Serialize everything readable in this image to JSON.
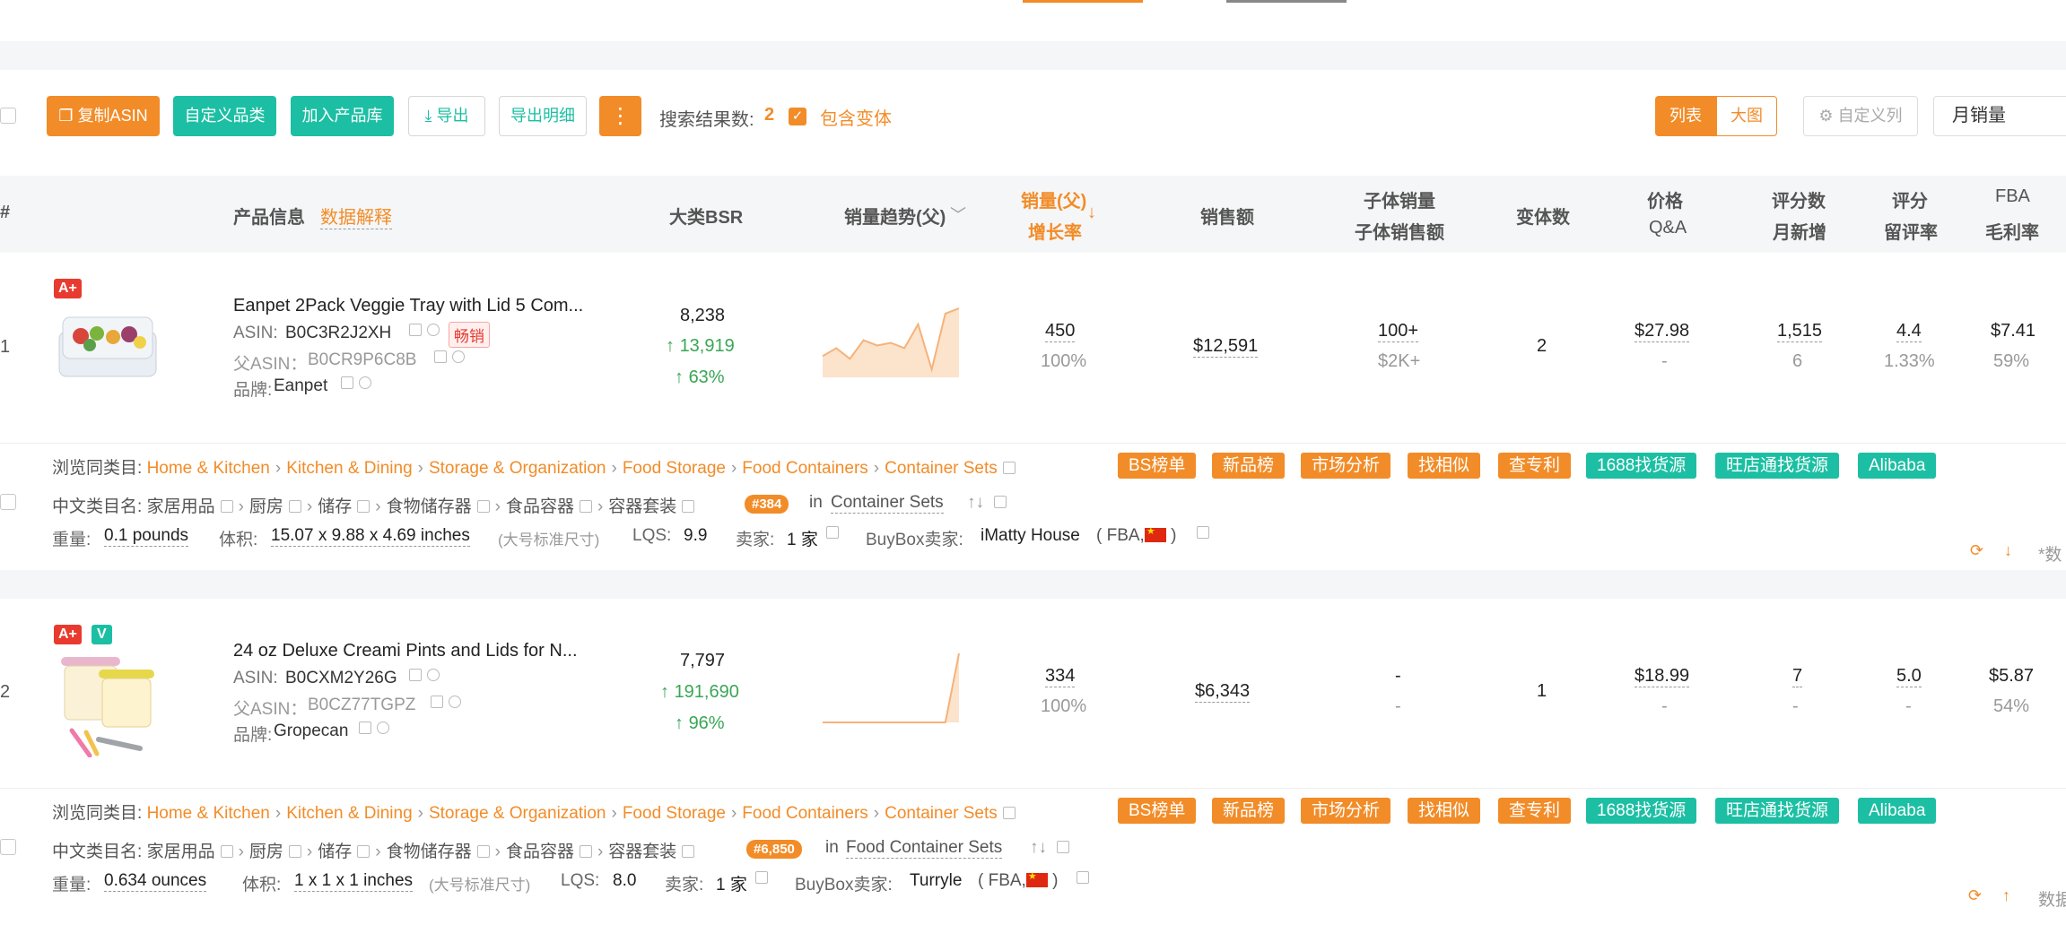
{
  "toolbar": {
    "copy_asin": "复制ASIN",
    "custom_category": "自定义品类",
    "add_library": "加入产品库",
    "export": "导出",
    "export_detail": "导出明细",
    "more": "⋮",
    "result_label": "搜索结果数:",
    "result_count": "2",
    "include_variants": "包含变体",
    "view_list": "列表",
    "view_grid": "大图",
    "custom_columns": "自定义列",
    "sort_select": "月销量"
  },
  "table": {
    "headers": {
      "index": "#",
      "product_info": "产品信息",
      "data_explain": "数据解释",
      "bsr": "大类BSR",
      "trend": "销量趋势(父)",
      "sales_parent": "销量(父)",
      "growth_rate": "增长率",
      "revenue": "销售额",
      "child_sales": "子体销量",
      "child_revenue": "子体销售额",
      "variants": "变体数",
      "price": "价格",
      "qa": "Q&A",
      "reviews": "评分数",
      "monthly_new": "月新增",
      "rating": "评分",
      "retention": "留评率",
      "fba": "FBA",
      "margin": "毛利率"
    },
    "rows": [
      {
        "index": "1",
        "badge_a": "A+",
        "title": "Eanpet 2Pack Veggie Tray with Lid 5 Com...",
        "asin_label": "ASIN:",
        "asin": "B0C3R2J2XH",
        "hot": "畅销",
        "parent_label": "父ASIN：",
        "parent_asin": "B0CR9P6C8B",
        "brand_label": "品牌:",
        "brand": "Eanpet",
        "bsr": "8,238",
        "bsr_change": "13,919",
        "bsr_pct": "63%",
        "sales": "450",
        "growth": "100%",
        "revenue": "$12,591",
        "child_sales": "100+",
        "child_revenue": "$2K+",
        "variants": "2",
        "price": "$27.98",
        "qa": "-",
        "reviews": "1,515",
        "monthly_new": "6",
        "rating": "4.4",
        "retention": "1.33%",
        "fba": "$7.41",
        "margin": "59%",
        "browse_label": "浏览同类目:",
        "crumbs": [
          "Home & Kitchen",
          "Kitchen & Dining",
          "Storage & Organization",
          "Food Storage",
          "Food Containers",
          "Container Sets"
        ],
        "cn_label": "中文类目名:",
        "cn_crumbs": [
          "家居用品",
          "厨房",
          "储存",
          "食物储存器",
          "食品容器",
          "容器套装"
        ],
        "rank": "#384",
        "rank_in": "in",
        "rank_cat": "Container Sets",
        "weight_label": "重量:",
        "weight": "0.1 pounds",
        "volume_label": "体积:",
        "volume": "15.07 x 9.88 x 4.69 inches",
        "size_note": "(大号标准尺寸)",
        "lqs_label": "LQS:",
        "lqs": "9.9",
        "seller_label": "卖家:",
        "seller": "1 家",
        "buybox_label": "BuyBox卖家:",
        "buybox": "iMatty House",
        "buybox_fba": "( FBA,",
        "buybox_close": ")",
        "trend": [
          40,
          55,
          35,
          70,
          60,
          65,
          55,
          100,
          15,
          120,
          130
        ]
      },
      {
        "index": "2",
        "badge_a": "A+",
        "badge_v": "V",
        "title": "24 oz Deluxe Creami Pints and Lids for N...",
        "asin_label": "ASIN:",
        "asin": "B0CXM2Y26G",
        "parent_label": "父ASIN：",
        "parent_asin": "B0CZ77TGPZ",
        "brand_label": "品牌:",
        "brand": "Gropecan",
        "bsr": "7,797",
        "bsr_change": "191,690",
        "bsr_pct": "96%",
        "sales": "334",
        "growth": "100%",
        "revenue": "$6,343",
        "child_sales": "-",
        "child_revenue": "-",
        "variants": "1",
        "price": "$18.99",
        "qa": "-",
        "reviews": "7",
        "monthly_new": "-",
        "rating": "5.0",
        "retention": "-",
        "fba": "$5.87",
        "margin": "54%",
        "browse_label": "浏览同类目:",
        "crumbs": [
          "Home & Kitchen",
          "Kitchen & Dining",
          "Storage & Organization",
          "Food Storage",
          "Food Containers",
          "Container Sets"
        ],
        "cn_label": "中文类目名:",
        "cn_crumbs": [
          "家居用品",
          "厨房",
          "储存",
          "食物储存器",
          "食品容器",
          "容器套装"
        ],
        "rank": "#6,850",
        "rank_in": "in",
        "rank_cat": "Food Container Sets",
        "weight_label": "重量:",
        "weight": "0.634 ounces",
        "volume_label": "体积:",
        "volume": "1 x 1 x 1 inches",
        "size_note": "(大号标准尺寸)",
        "lqs_label": "LQS:",
        "lqs": "8.0",
        "seller_label": "卖家:",
        "seller": "1 家",
        "buybox_label": "BuyBox卖家:",
        "buybox": "Turryle",
        "buybox_fba": "( FBA,",
        "buybox_close": ")",
        "trend": [
          0,
          0,
          0,
          0,
          0,
          0,
          0,
          0,
          0,
          0,
          130
        ]
      }
    ]
  },
  "action_tags": {
    "bs": "BS榜单",
    "new": "新品榜",
    "market": "市场分析",
    "similar": "找相似",
    "patent": "查专利",
    "src1688": "1688找货源",
    "wangdian": "旺店通找货源",
    "alibaba": "Alibaba"
  },
  "row_tail": {
    "row1_note": "*数",
    "row2_note": "数据"
  },
  "colors": {
    "accent": "#f28c28",
    "teal": "#1cbfa3",
    "green": "#3aa655"
  }
}
